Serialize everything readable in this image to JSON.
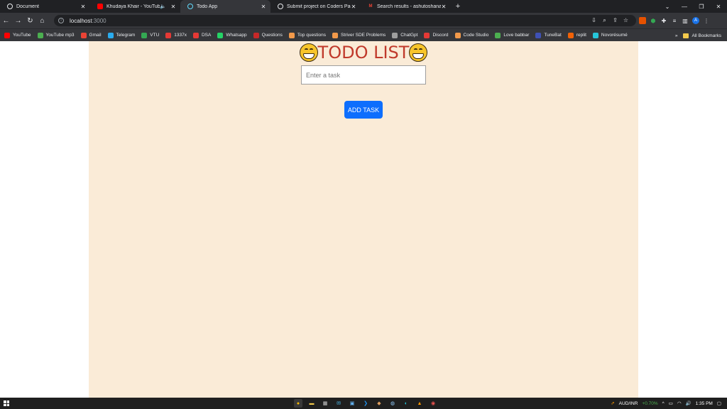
{
  "browser": {
    "tabs": [
      {
        "title": "Document",
        "active": false
      },
      {
        "title": "Khudaya Khair - YouTube",
        "active": false
      },
      {
        "title": "Todo App",
        "active": true
      },
      {
        "title": "Submit project on Coders Packet",
        "active": false
      },
      {
        "title": "Search results - ashutoshanand",
        "active": false
      }
    ],
    "address": {
      "host": "localhost",
      "port": ":3000"
    },
    "bookmarks": [
      {
        "label": "YouTube",
        "color": "#ff0000"
      },
      {
        "label": "YouTube mp3",
        "color": "#4caf50"
      },
      {
        "label": "Gmail",
        "color": "#ea4335"
      },
      {
        "label": "Telegram",
        "color": "#2aabee"
      },
      {
        "label": "VTU",
        "color": "#34a853"
      },
      {
        "label": "1337x",
        "color": "#e53935"
      },
      {
        "label": "DSA",
        "color": "#e53935"
      },
      {
        "label": "Whatsapp",
        "color": "#25d366"
      },
      {
        "label": "Questions",
        "color": "#c62828"
      },
      {
        "label": "Top questions",
        "color": "#f2994a"
      },
      {
        "label": "Striver SDE Problems",
        "color": "#f2994a"
      },
      {
        "label": "ChatGpt",
        "color": "#9e9e9e"
      },
      {
        "label": "Discord",
        "color": "#e53935"
      },
      {
        "label": "Code Studio",
        "color": "#f2994a"
      },
      {
        "label": "Love babbar",
        "color": "#4caf50"
      },
      {
        "label": "TuneBat",
        "color": "#3f51b5"
      },
      {
        "label": "replit",
        "color": "#f26207"
      },
      {
        "label": "Novorésumé",
        "color": "#26c6da"
      }
    ],
    "all_bookmarks_label": "All Bookmarks"
  },
  "app": {
    "title": "TODO LIST",
    "input_placeholder": "Enter a task",
    "input_value": "",
    "add_button_label": "ADD TASK",
    "accent_color": "#0d6efd",
    "background_color": "#faebd7",
    "title_color": "#c0392b"
  },
  "taskbar": {
    "ticker": "AUD/INR",
    "ticker_change": "+0.70%",
    "time": "1:35 PM"
  }
}
